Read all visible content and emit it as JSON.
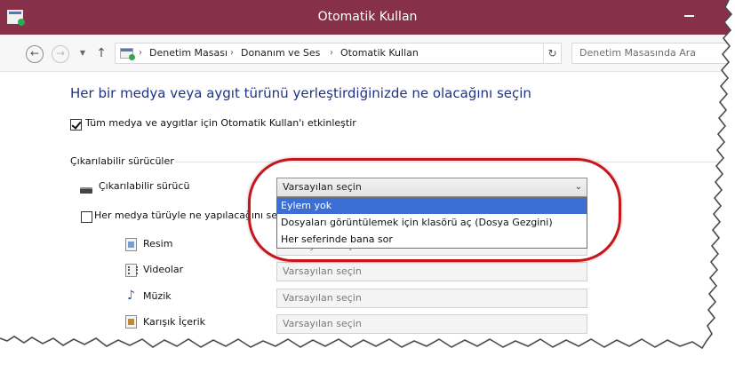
{
  "window": {
    "title": "Otomatik Kullan",
    "accent_color": "#86304a"
  },
  "navigation": {
    "back_icon": "back-arrow-icon",
    "forward_icon": "forward-arrow-icon",
    "up_icon": "up-arrow-icon",
    "breadcrumbs": [
      "Denetim Masası",
      "Donanım ve Ses",
      "Otomatik Kullan"
    ],
    "search_placeholder": "Denetim Masasında Ara"
  },
  "content": {
    "heading": "Her bir medya veya aygıt türünü yerleştirdiğinizde ne olacağını seçin",
    "autoplay_checkbox": {
      "label": "Tüm medya ve aygıtlar için Otomatik Kullan'ı etkinleştir",
      "checked": true
    },
    "removable_section": {
      "title": "Çıkarılabilir sürücüler",
      "drive_label": "Çıkarılabilir sürücü",
      "selected_value": "Varsayılan seçin",
      "dropdown_options": [
        "Eylem yok",
        "Dosyaları görüntülemek için klasörü aç (Dosya Gezgini)",
        "Her seferinde bana sor"
      ],
      "highlighted_option": "Eylem yok"
    },
    "each_media_checkbox": {
      "label": "Her medya türüyle ne yapılacağını seçin",
      "checked": false
    },
    "media_types": [
      {
        "label": "Resim",
        "icon": "picture-icon",
        "value": "Varsayılan seçin"
      },
      {
        "label": "Videolar",
        "icon": "video-icon",
        "value": "Varsayılan seçin"
      },
      {
        "label": "Müzik",
        "icon": "music-note-icon",
        "value": "Varsayılan seçin"
      },
      {
        "label": "Karışık İçerik",
        "icon": "mixed-content-icon",
        "value": "Varsayılan seçin"
      }
    ]
  },
  "annotation": {
    "highlight_color": "#c5161c"
  }
}
